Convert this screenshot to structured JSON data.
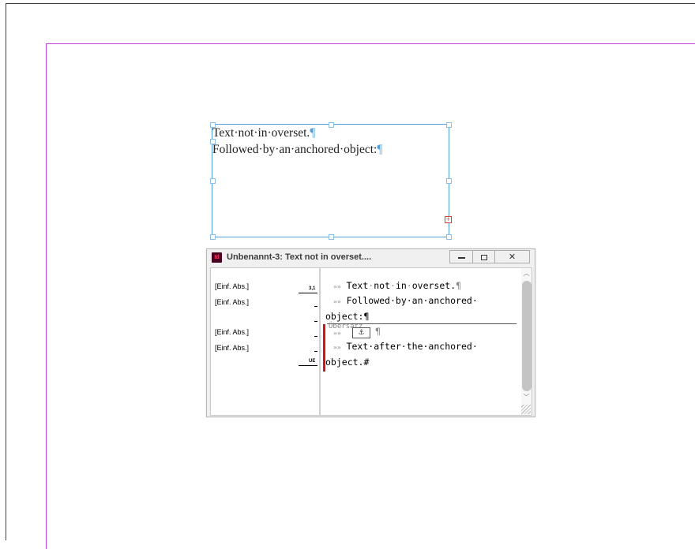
{
  "canvas": {
    "colors": {
      "margin_guide": "#c23bdb",
      "frame_border": "#4f9fde",
      "overset_red": "#d3141b"
    }
  },
  "text_frame": {
    "line1": "Text·not·in·overset.",
    "line2": "Followed·by·an·anchored·object:",
    "pilcrow": "¶",
    "overset_port_icon": "overset-plus-icon"
  },
  "story_editor": {
    "title": "Unbenannt-3: Text not in overset....",
    "app_icon_label": "Id",
    "buttons": {
      "minimize_icon": "minimize-icon",
      "maximize_icon": "maximize-icon",
      "close_label": "✕"
    },
    "style_labels": [
      "[Einf. Abs.]",
      "[Einf. Abs.]",
      "[Einf. Abs.]",
      "[Einf. Abs.]"
    ],
    "depth_ruler": {
      "top_value": "3,1",
      "bottom_value": "UE"
    },
    "lines": {
      "l1": "Text·in·overset.¶",
      "l1_prefix_text": "Text",
      "l1_prefix_not": "not",
      "l2": "Followed·by·an·anchored·",
      "l3": "object:¶",
      "l4_pilcrow": "¶",
      "l5": "Text·after·the·anchored·",
      "l6": "object.#"
    },
    "overset_label": "Übersatz",
    "anchor_icon": "anchor-icon",
    "tab_glyph": "»»"
  }
}
